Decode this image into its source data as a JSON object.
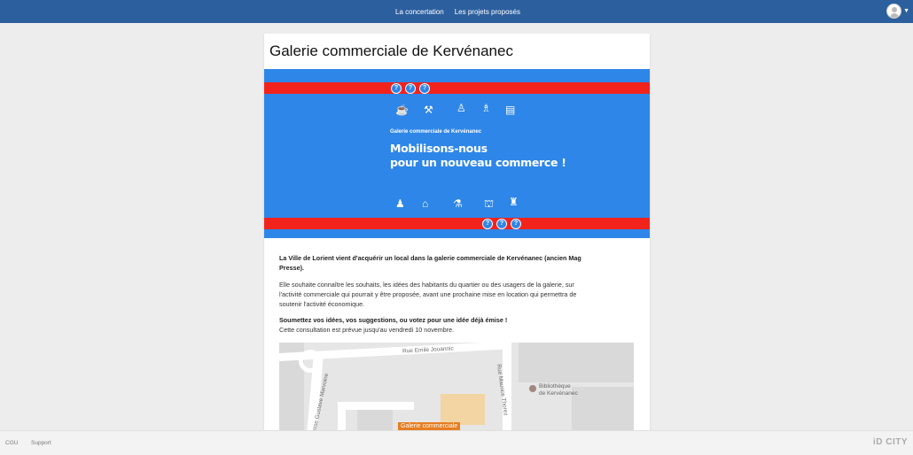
{
  "nav": {
    "concertation": "La concertation",
    "projets": "Les projets proposés"
  },
  "page": {
    "title": "Galerie commerciale de Kervénanec"
  },
  "banner": {
    "subtitle": "Galerie commerciale de Kervénanec",
    "headline_line1": "Mobilisons-nous",
    "headline_line2": "pour un nouveau commerce !",
    "circle_glyph": "?",
    "colors": {
      "background": "#2e86e8",
      "stripe": "#f2231d"
    },
    "top_icons": [
      "pizza-icon",
      "bar-table-icon",
      "person-icon",
      "barber-icon",
      "shop-icon"
    ],
    "bottom_icons": [
      "chef-icon",
      "counter-icon",
      "desk-icon",
      "market-stall-icon",
      "cook-icon"
    ]
  },
  "content": {
    "intro": "La Ville de Lorient vient d'acquérir un local dans la galerie commerciale de Kervénanec (ancien Mag Presse).",
    "description": "Elle souhaite connaître les souhaits, les idées des habitants du quartier ou des usagers de la galerie, sur l'activité commerciale qui pourrait y être proposée, avant une prochaine mise en location qui permettra de soutenir l'activité économique.",
    "cta_bold": "Soumettez vos idées, vos suggestions, ou votez pour une idée déjà émise !",
    "deadline": "Cette consultation est prévue jusqu'au vendredi 10 novembre."
  },
  "map": {
    "street1": "Rue Emile Jouannic",
    "street2": "Impasse Gustave Marvoine",
    "street3": "Rue Maurice Thorez",
    "poi_line1": "Bibliothèque",
    "poi_line2": "de Kervénanec",
    "marker": "Galerie commerciale"
  },
  "footer": {
    "cgu": "CGU",
    "support": "Support",
    "brand": "iD CITY"
  },
  "colors": {
    "topbar": "#2c5f9e",
    "marker": "#e67e22"
  }
}
